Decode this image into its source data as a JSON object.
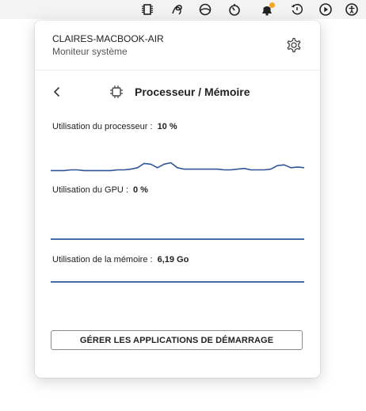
{
  "menubar": {
    "icons": [
      "cpu-chip-icon",
      "scribble-icon",
      "circle-icon",
      "timer-icon",
      "notification-bell-icon",
      "clock-history-icon",
      "play-circle-icon",
      "accessibility-icon"
    ],
    "notification_color": "#f5a623"
  },
  "popover": {
    "computer_name": "CLAIRES-MACBOOK-AIR",
    "app_title": "Moniteur système",
    "section_title": "Processeur / Mémoire",
    "cpu": {
      "label": "Utilisation du processeur :",
      "value": "10 %",
      "history": [
        4,
        4,
        4,
        5,
        5,
        4,
        4,
        4,
        4,
        4,
        5,
        5,
        6,
        8,
        14,
        13,
        8,
        13,
        15,
        8,
        6,
        6,
        6,
        6,
        6,
        6,
        5,
        5,
        6,
        7,
        5,
        5,
        5,
        6,
        11,
        12,
        8,
        9,
        8
      ]
    },
    "gpu": {
      "label": "Utilisation du GPU :",
      "value": "0 %"
    },
    "memory": {
      "label": "Utilisation de la mémoire :",
      "value": "6,19 Go"
    },
    "startup_button": "GÉRER LES APPLICATIONS DE DÉMARRAGE",
    "graph_color": "#2f5597"
  }
}
